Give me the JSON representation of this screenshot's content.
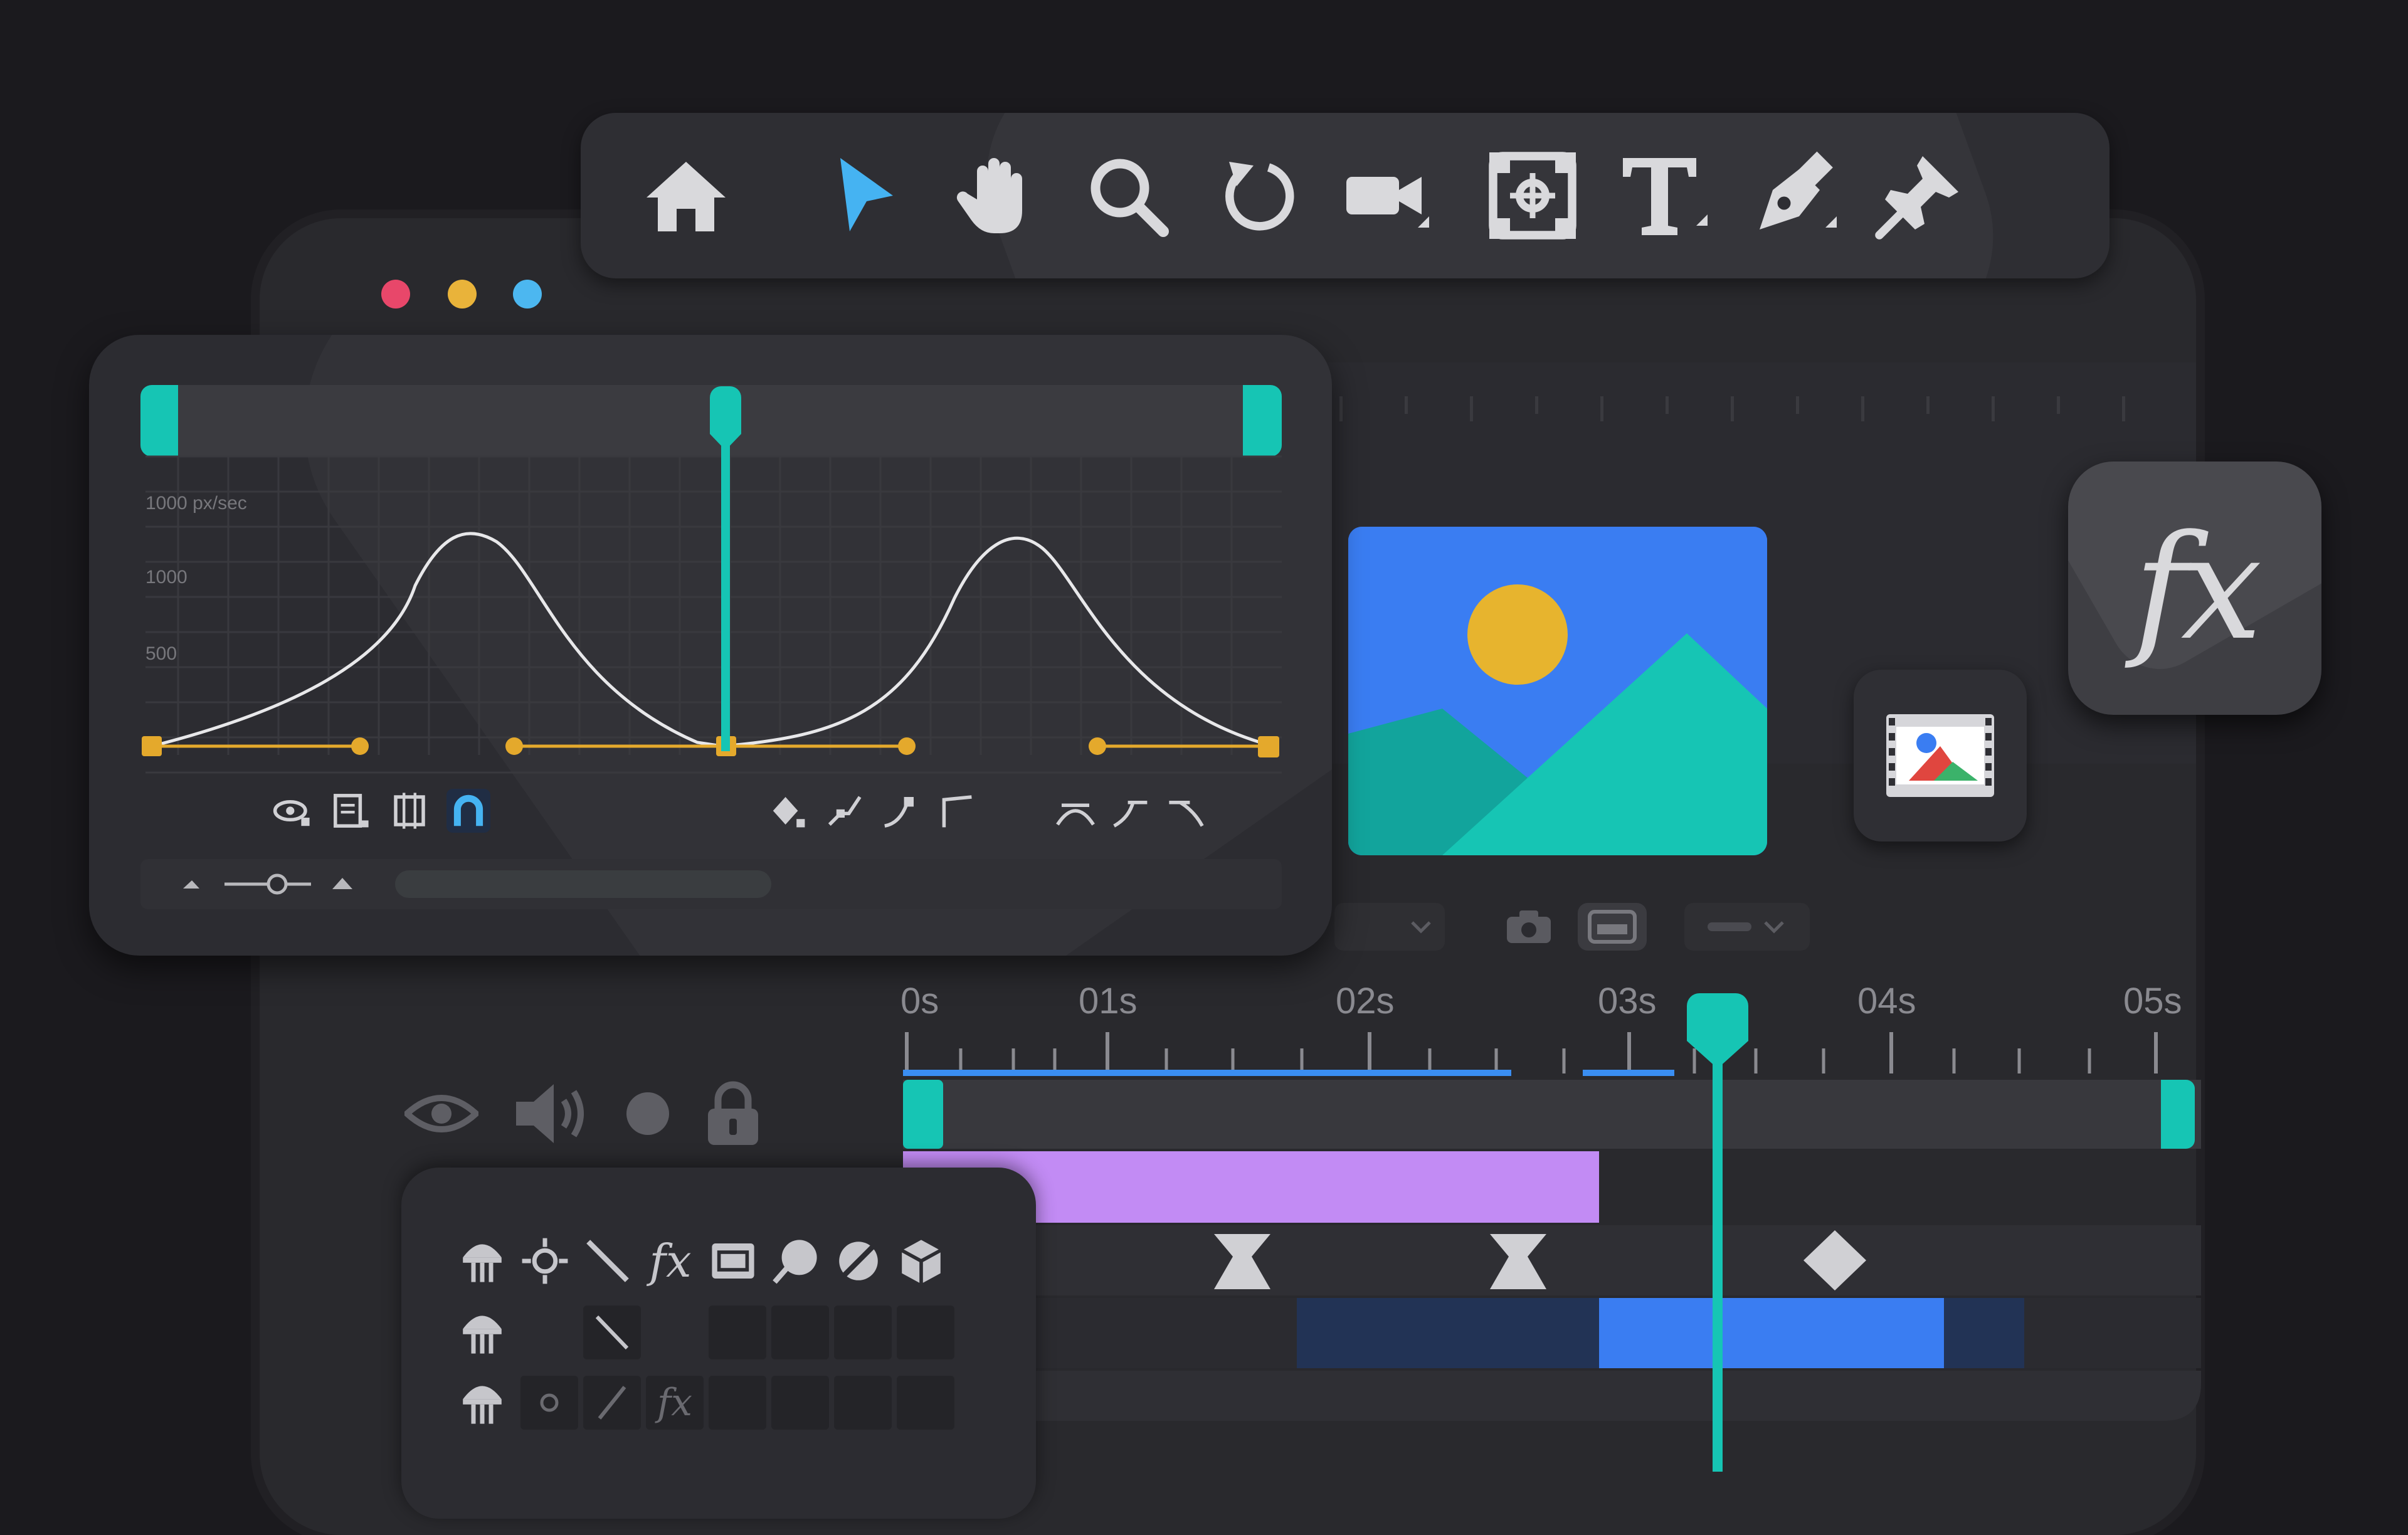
{
  "window": {
    "traffic_lights": [
      "#e8476a",
      "#e9b33a",
      "#4cb7f0"
    ]
  },
  "toolbar": {
    "tools": [
      {
        "name": "home",
        "icon": "home-icon"
      },
      {
        "name": "selection",
        "icon": "cursor-arrow-icon",
        "active": true
      },
      {
        "name": "hand",
        "icon": "hand-icon"
      },
      {
        "name": "zoom",
        "icon": "magnifier-icon"
      },
      {
        "name": "rotate",
        "icon": "rotate-icon"
      },
      {
        "name": "camera",
        "icon": "video-camera-icon"
      },
      {
        "name": "anchor-point",
        "icon": "anchor-point-icon"
      },
      {
        "name": "type",
        "icon": "type-icon"
      },
      {
        "name": "pen",
        "icon": "pen-icon"
      },
      {
        "name": "puppet-pin",
        "icon": "pin-icon"
      }
    ]
  },
  "graph_editor": {
    "y_labels": [
      "1000 px/sec",
      "1000",
      "500"
    ],
    "bottom_icons": [
      "eye-icon",
      "fit-icon",
      "frame-icon",
      "snap-magnet-icon",
      "keyframe-icon",
      "convert-vertex-icon",
      "ease-icon",
      "corner-icon",
      "easy-ease-icon",
      "ease-in-icon",
      "ease-out-icon"
    ],
    "zoom_icons": [
      "zoom-out-mountain-icon",
      "zoom-slider-icon",
      "zoom-in-mountain-icon"
    ]
  },
  "viewer": {
    "controls": [
      "resolution-dropdown",
      "snapshot-camera-icon",
      "show-snapshot-icon",
      "resolution-full-dropdown"
    ],
    "tiles": [
      "media-film-icon",
      "fx"
    ],
    "fx_label": "fx"
  },
  "timeline": {
    "time_labels": [
      "0s",
      "01s",
      "02s",
      "03s",
      "04s",
      "05s"
    ],
    "layer_switch_icons": [
      "eye-icon",
      "speaker-icon",
      "solo-dot-icon",
      "lock-icon"
    ]
  },
  "layer_panel": {
    "icons": [
      "shy-icon",
      "collapse-icon",
      "quality-icon",
      "fx",
      "frame-blend-icon",
      "motion-blur-icon",
      "adjustment-layer-icon",
      "3d-layer-icon"
    ],
    "fx_label": "fx"
  },
  "colors": {
    "accent_teal": "#16c5b4",
    "accent_blue": "#3a7df2",
    "clip_purple": "#c28bf4",
    "keyframe_amber": "#e4a92c",
    "active_tool_blue": "#45b3f2"
  }
}
